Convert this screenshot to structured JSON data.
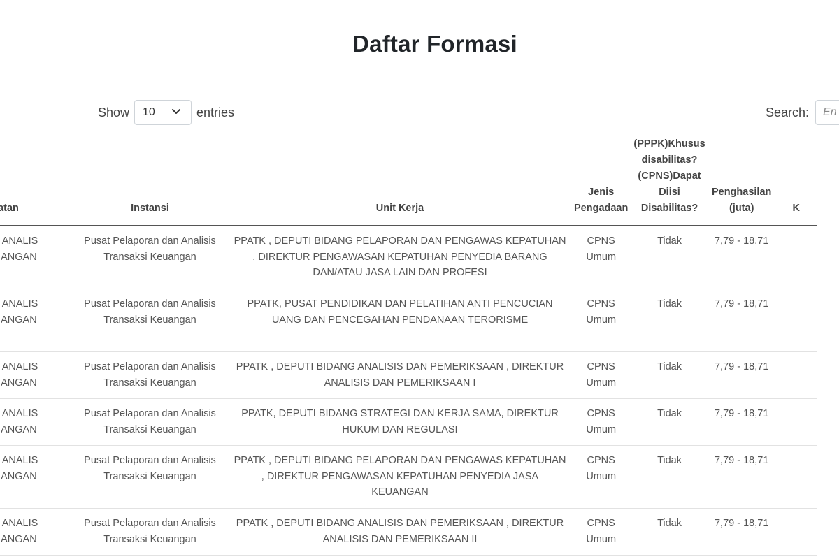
{
  "page_title": "Daftar Formasi",
  "length": {
    "show_label": "Show",
    "selected": "10",
    "entries_label": "entries"
  },
  "search": {
    "label": "Search:",
    "placeholder": "En"
  },
  "table": {
    "headers": {
      "jabatan": "atan",
      "instansi": "Instansi",
      "unit_kerja": "Unit Kerja",
      "jenis": "Jenis Pengadaan",
      "disabilitas": "(PPPK)Khusus disabilitas? (CPNS)Dapat Diisi Disabilitas?",
      "penghasilan": "Penghasilan (juta)",
      "next": "K"
    },
    "rows": [
      {
        "jabatan": "MA - ANALIS KEUANGAN",
        "instansi": "Pusat Pelaporan dan Analisis Transaksi Keuangan",
        "unit_kerja": "PPATK , DEPUTI BIDANG PELAPORAN DAN PENGAWAS KEPATUHAN , DIREKTUR PENGAWASAN KEPATUHAN PENYEDIA BARANG DAN/ATAU JASA LAIN DAN PROFESI",
        "jenis": "CPNS Umum",
        "disabilitas": "Tidak",
        "penghasilan": "7,79 - 18,71"
      },
      {
        "jabatan": "MA - ANALIS KEUANGAN",
        "instansi": "Pusat Pelaporan dan Analisis Transaksi Keuangan",
        "unit_kerja": "PPATK, PUSAT PENDIDIKAN DAN PELATIHAN ANTI PENCUCIAN UANG DAN PENCEGAHAN PENDANAAN TERORISME",
        "jenis": "CPNS Umum",
        "disabilitas": "Tidak",
        "penghasilan": "7,79 - 18,71"
      },
      {
        "jabatan": "MA - ANALIS KEUANGAN",
        "instansi": "Pusat Pelaporan dan Analisis Transaksi Keuangan",
        "unit_kerja": "PPATK , DEPUTI BIDANG ANALISIS DAN PEMERIKSAAN , DIREKTUR ANALISIS DAN PEMERIKSAAN I",
        "jenis": "CPNS Umum",
        "disabilitas": "Tidak",
        "penghasilan": "7,79 - 18,71"
      },
      {
        "jabatan": "MA - ANALIS KEUANGAN",
        "instansi": "Pusat Pelaporan dan Analisis Transaksi Keuangan",
        "unit_kerja": "PPATK, DEPUTI BIDANG STRATEGI DAN KERJA SAMA, DIREKTUR HUKUM DAN REGULASI",
        "jenis": "CPNS Umum",
        "disabilitas": "Tidak",
        "penghasilan": "7,79 - 18,71"
      },
      {
        "jabatan": "MA - ANALIS KEUANGAN",
        "instansi": "Pusat Pelaporan dan Analisis Transaksi Keuangan",
        "unit_kerja": "PPATK , DEPUTI BIDANG PELAPORAN DAN PENGAWAS KEPATUHAN , DIREKTUR PENGAWASAN KEPATUHAN PENYEDIA JASA KEUANGAN",
        "jenis": "CPNS Umum",
        "disabilitas": "Tidak",
        "penghasilan": "7,79 - 18,71"
      },
      {
        "jabatan": "MA - ANALIS KEUANGAN",
        "instansi": "Pusat Pelaporan dan Analisis Transaksi Keuangan",
        "unit_kerja": "PPATK , DEPUTI BIDANG ANALISIS DAN PEMERIKSAAN , DIREKTUR ANALISIS DAN PEMERIKSAAN II",
        "jenis": "CPNS Umum",
        "disabilitas": "Tidak",
        "penghasilan": "7,79 - 18,71"
      }
    ]
  }
}
